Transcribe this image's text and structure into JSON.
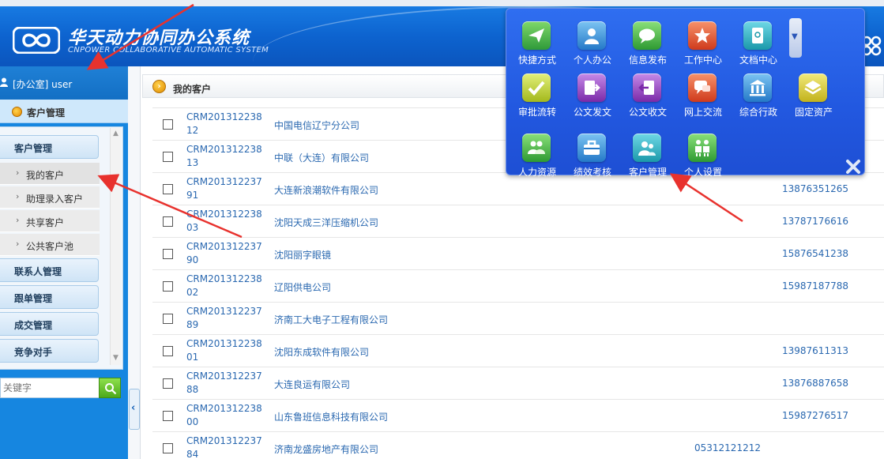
{
  "header": {
    "title": "华天动力协同办公系统",
    "subtitle": "CNPOWER COLLABORATIVE AUTOMATIC SYSTEM"
  },
  "user": {
    "label": "[办公室] user"
  },
  "sidebar": {
    "module": "客户管理",
    "groups": [
      {
        "label": "客户管理"
      },
      {
        "label": "联系人管理"
      },
      {
        "label": "跟单管理"
      },
      {
        "label": "成交管理"
      },
      {
        "label": "竞争对手"
      }
    ],
    "sub_items": [
      {
        "label": "我的客户"
      },
      {
        "label": "助理录入客户"
      },
      {
        "label": "共享客户"
      },
      {
        "label": "公共客户池"
      }
    ],
    "search_placeholder": "关键字"
  },
  "content": {
    "title": "我的客户",
    "rows": [
      {
        "crm": "CRM20131223812",
        "name": "中国电信辽宁分公司",
        "phone": "",
        "phone2": ""
      },
      {
        "crm": "CRM20131223813",
        "name": "中联（大连）有限公司",
        "phone": "",
        "phone2": ""
      },
      {
        "crm": "CRM20131223791",
        "name": "大连新浪潮软件有限公司",
        "phone": "13876351265",
        "phone2": ""
      },
      {
        "crm": "CRM20131223803",
        "name": "沈阳天成三洋压缩机公司",
        "phone": "13787176616",
        "phone2": ""
      },
      {
        "crm": "CRM20131223790",
        "name": "沈阳丽字眼镜",
        "phone": "15876541238",
        "phone2": ""
      },
      {
        "crm": "CRM20131223802",
        "name": "辽阳供电公司",
        "phone": "15987187788",
        "phone2": ""
      },
      {
        "crm": "CRM20131223789",
        "name": "济南工大电子工程有限公司",
        "phone": "",
        "phone2": ""
      },
      {
        "crm": "CRM20131223801",
        "name": "沈阳东成软件有限公司",
        "phone": "13987611313",
        "phone2": ""
      },
      {
        "crm": "CRM20131223788",
        "name": "大连良运有限公司",
        "phone": "13876887658",
        "phone2": ""
      },
      {
        "crm": "CRM20131223800",
        "name": "山东鲁班信息科技有限公司",
        "phone": "15987276517",
        "phone2": ""
      },
      {
        "crm": "CRM20131223784",
        "name": "济南龙盛房地产有限公司",
        "phone": "",
        "phone2": "05312121212"
      }
    ]
  },
  "launcher": {
    "apps": [
      {
        "label": "快捷方式",
        "icon": "paper-plane-icon",
        "color": "#3aa84a"
      },
      {
        "label": "个人办公",
        "icon": "person-icon",
        "color": "#2f8fd8"
      },
      {
        "label": "信息发布",
        "icon": "chat-bubble-icon",
        "color": "#38a83a"
      },
      {
        "label": "工作中心",
        "icon": "star-icon",
        "color": "#e0502c"
      },
      {
        "label": "文档中心",
        "icon": "document-icon",
        "color": "#22a8b8"
      },
      {
        "label": "审批流转",
        "icon": "check-icon",
        "color": "#a8c82a"
      },
      {
        "label": "公文发文",
        "icon": "send-doc-icon",
        "color": "#9a3ec8"
      },
      {
        "label": "公文收文",
        "icon": "receive-doc-icon",
        "color": "#9a3ec8"
      },
      {
        "label": "网上交流",
        "icon": "speech-icon",
        "color": "#e0502c"
      },
      {
        "label": "综合行政",
        "icon": "building-icon",
        "color": "#2f8fd8"
      },
      {
        "label": "固定资产",
        "icon": "layers-icon",
        "color": "#d8c82a"
      },
      {
        "label": "人力资源",
        "icon": "people-icon",
        "color": "#3aa84a"
      },
      {
        "label": "绩效考核",
        "icon": "briefcase-icon",
        "color": "#2f8fd8"
      },
      {
        "label": "客户管理",
        "icon": "customers-icon",
        "color": "#22a8b8"
      },
      {
        "label": "个人设置",
        "icon": "settings-people-icon",
        "color": "#3aa84a"
      }
    ]
  },
  "colors": {
    "header_blue": "#0d63cf",
    "link_blue": "#2a68b0",
    "annotation_red": "#e8322e"
  }
}
